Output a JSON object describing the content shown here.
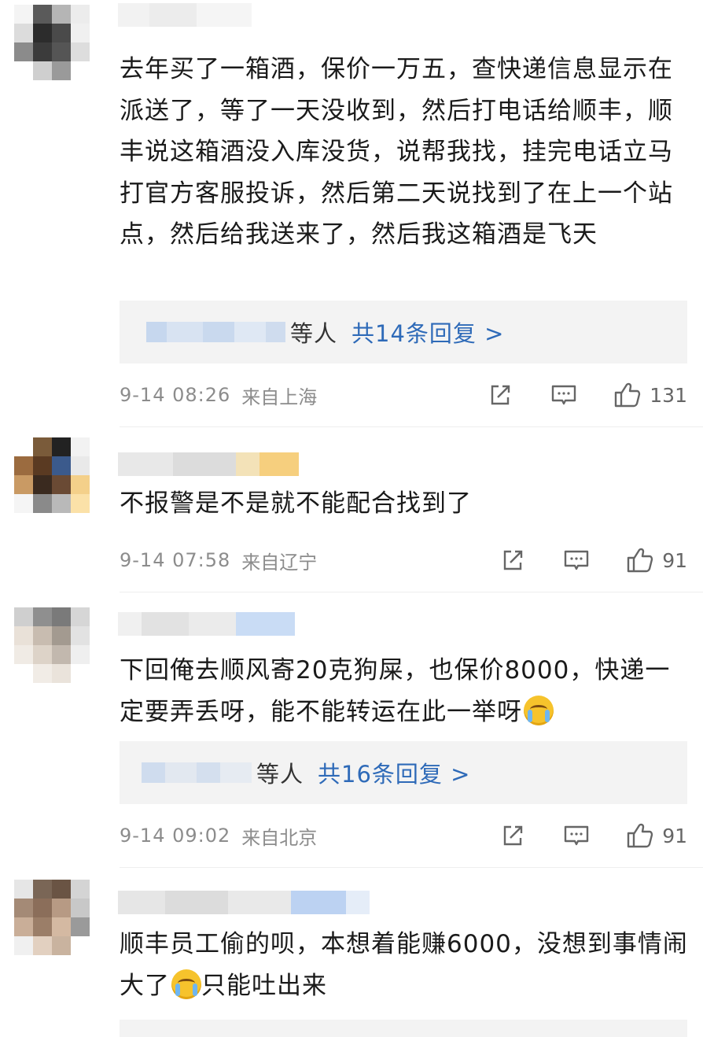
{
  "colors": {
    "link": "#2e6ab8",
    "reply_bg": "#f3f3f3",
    "meta": "#8c8c8c"
  },
  "comments": [
    {
      "text": "去年买了一箱酒，保价一万五，查快递信息显示在派送了，等了一天没收到，然后打电话给顺丰，顺丰说这箱酒没入库没货，说帮我找，挂完电话立马打官方客服投诉，然后第二天说找到了在上一个站点，然后给我送来了，然后我这箱酒是飞天",
      "reply_names": "等人",
      "reply_count": "共14条回复 >",
      "time": "9-14 08:26",
      "location": "来自上海",
      "likes": "131"
    },
    {
      "text": "不报警是不是就不能配合找到了",
      "time": "9-14 07:58",
      "location": "来自辽宁",
      "likes": "91"
    },
    {
      "text": "下回俺去顺风寄20克狗屎，也保价8000，快递一定要弄丢呀，能不能转运在此一举呀",
      "reply_names": "等人",
      "reply_count": "共16条回复 >",
      "time": "9-14 09:02",
      "location": "来自北京",
      "likes": "91"
    },
    {
      "text_before": "顺丰员工偷的呗，本想着能赚6000，没想到事情闹大了",
      "text_after": "只能吐出来"
    }
  ],
  "icons": [
    "share-icon",
    "comment-icon",
    "like-icon",
    "crying-emoji-icon"
  ]
}
